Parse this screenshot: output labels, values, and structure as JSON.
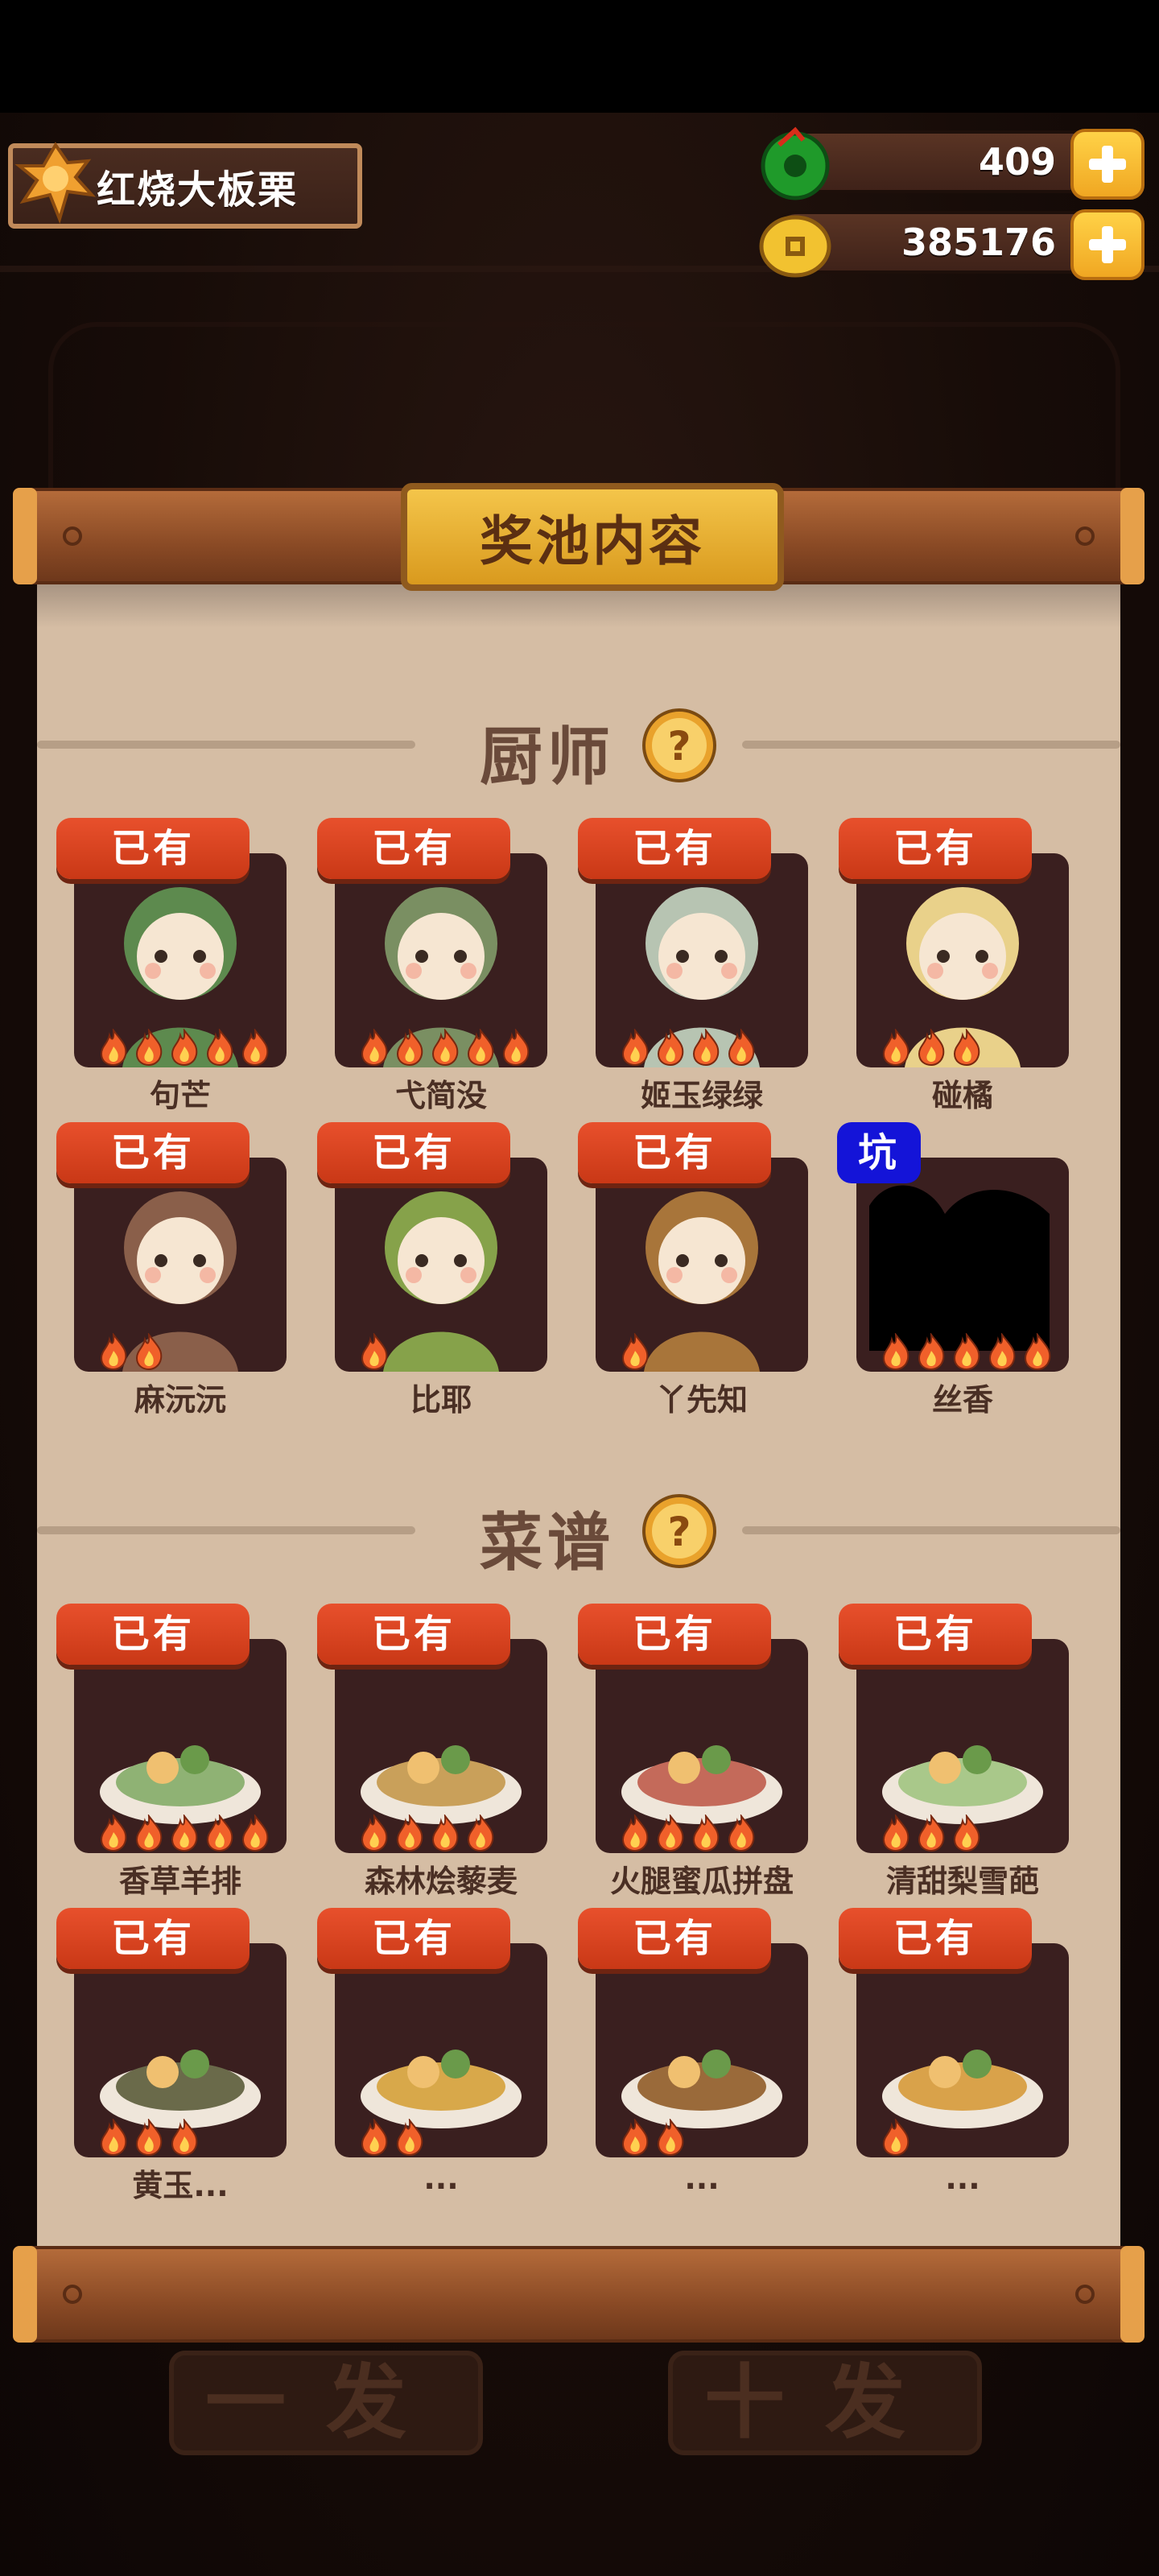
{
  "player": {
    "name": "红烧大板栗"
  },
  "resources": {
    "jade": "409",
    "coins": "385176"
  },
  "panel": {
    "title": "奖池内容"
  },
  "chef_section": {
    "title": "厨师",
    "cards": [
      {
        "name": "句芒",
        "badge": "已有",
        "flames": 5,
        "tint": "#5d8a4e"
      },
      {
        "name": "弋简没",
        "badge": "已有",
        "flames": 5,
        "tint": "#7a8f62"
      },
      {
        "name": "姬玉绿绿",
        "badge": "已有",
        "flames": 4,
        "tint": "#b7c4b2"
      },
      {
        "name": "碰橘",
        "badge": "已有",
        "flames": 3,
        "tint": "#e9d18a"
      },
      {
        "name": "麻沅沅",
        "badge": "已有",
        "flames": 2,
        "tint": "#8a5f4a"
      },
      {
        "name": "比耶",
        "badge": "已有",
        "flames": 1,
        "tint": "#86a24a"
      },
      {
        "name": "丫先知",
        "badge": "已有",
        "flames": 1,
        "tint": "#a8753a"
      },
      {
        "name": "丝香",
        "badge": "坑",
        "flames": 5,
        "tint": "#000000"
      }
    ]
  },
  "recipe_section": {
    "title": "菜谱",
    "cards": [
      {
        "name": "香草羊排",
        "badge": "已有",
        "flames": 5,
        "tint": "#8fb274"
      },
      {
        "name": "森林烩藜麦",
        "badge": "已有",
        "flames": 4,
        "tint": "#c9a05a"
      },
      {
        "name": "火腿蜜瓜拼盘",
        "badge": "已有",
        "flames": 4,
        "tint": "#c46a5a"
      },
      {
        "name": "清甜梨雪葩",
        "badge": "已有",
        "flames": 3,
        "tint": "#a9c88a"
      },
      {
        "name": "黄玉...",
        "badge": "已有",
        "flames": 3,
        "tint": "#6a6a4a"
      },
      {
        "name": "...",
        "badge": "已有",
        "flames": 2,
        "tint": "#d8a84a"
      },
      {
        "name": "...",
        "badge": "已有",
        "flames": 2,
        "tint": "#9a6a3a"
      },
      {
        "name": "...",
        "badge": "已有",
        "flames": 1,
        "tint": "#d9a24a"
      }
    ]
  },
  "background_buttons": {
    "single": "一发",
    "ten": "十发"
  },
  "colors": {
    "badge_owned": "#d8441e",
    "badge_pit": "#1414d8",
    "paper": "#d5bda4",
    "card": "#3a1f1f"
  }
}
